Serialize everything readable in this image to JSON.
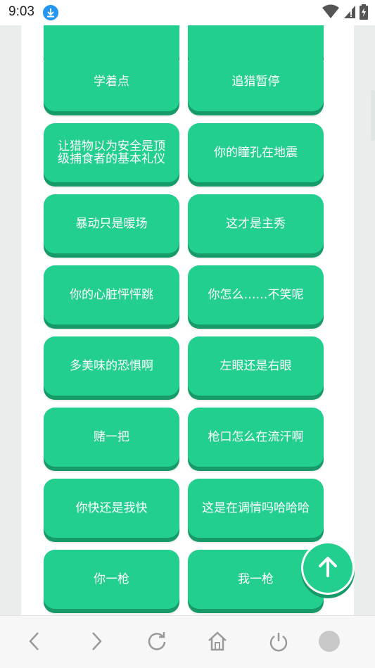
{
  "status_bar": {
    "time": "9:03",
    "icons": [
      "download-icon",
      "wifi-icon",
      "signal-icon",
      "battery-icon"
    ]
  },
  "buttons": [
    {
      "label": ""
    },
    {
      "label": ""
    },
    {
      "label": "学着点"
    },
    {
      "label": "追猎暂停"
    },
    {
      "label": "让猎物以为安全是顶级捕食者的基本礼仪"
    },
    {
      "label": "你的瞳孔在地震"
    },
    {
      "label": "暴动只是暖场"
    },
    {
      "label": "这才是主秀"
    },
    {
      "label": "你的心脏怦怦跳"
    },
    {
      "label": "你怎么……不笑呢"
    },
    {
      "label": "多美味的恐惧啊"
    },
    {
      "label": "左眼还是右眼"
    },
    {
      "label": "赌一把"
    },
    {
      "label": "枪口怎么在流汗啊"
    },
    {
      "label": "你快还是我快"
    },
    {
      "label": "这是在调情吗哈哈哈"
    },
    {
      "label": "你一枪"
    },
    {
      "label": "我一枪"
    }
  ],
  "fab": {
    "icon": "arrow-up-icon"
  },
  "nav_bar": {
    "icons": [
      "back-icon",
      "forward-icon",
      "refresh-icon",
      "home-icon",
      "power-icon",
      "menu-circle-icon"
    ]
  },
  "colors": {
    "button": "#23cf8f",
    "button_shadow": "#169a68",
    "background": "#e9eeec"
  }
}
